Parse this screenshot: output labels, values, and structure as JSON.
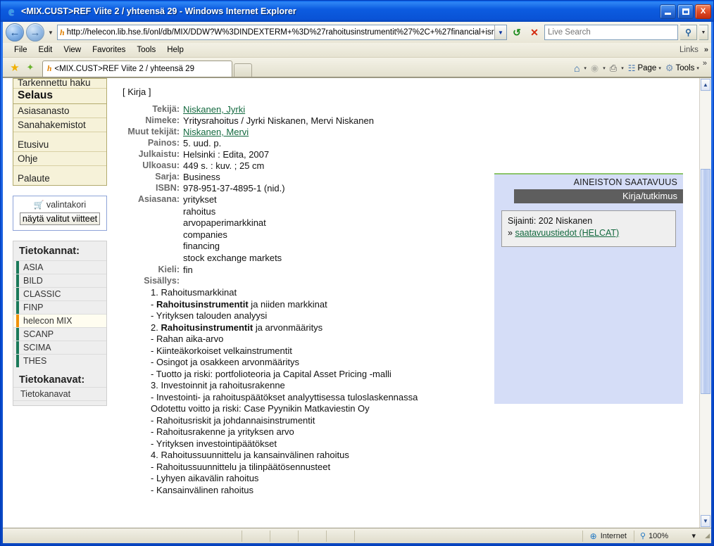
{
  "window": {
    "title": "<MIX.CUST>REF Viite 2 / yhteensä 29 - Windows Internet Explorer",
    "minimize_label": "Minimize",
    "maximize_label": "Maximize",
    "close_label": "X"
  },
  "address_bar": {
    "back_glyph": "←",
    "forward_glyph": "→",
    "history_glyph": "▼",
    "url": "http://helecon.lib.hse.fi/onl/db/MIX/DDW?W%3DINDEXTERM+%3D%27rahoitusinstrumentit%27%2C+%27financial+isr",
    "favicon_glyph": "h",
    "dropdown_glyph": "▼",
    "refresh_glyph": "↺",
    "stop_glyph": "✕",
    "search_placeholder": "Live Search",
    "search_value": "",
    "search_go_glyph": "⚲",
    "search_drop_glyph": "▼"
  },
  "menubar": {
    "items": [
      "File",
      "Edit",
      "View",
      "Favorites",
      "Tools",
      "Help"
    ],
    "links_label": "Links",
    "overflow_glyph": "»"
  },
  "tabrow": {
    "favorites_glyph": "★",
    "add_favorite_glyph": "✦",
    "tab_label": "<MIX.CUST>REF Viite 2 / yhteensä 29",
    "tab_favicon": "h",
    "new_tab_label": "",
    "commands": [
      {
        "name": "home",
        "icon": "⌂",
        "label": "",
        "arrow": "▾"
      },
      {
        "name": "feeds",
        "icon": "◉",
        "label": "",
        "arrow": "▾"
      },
      {
        "name": "print",
        "icon": "⎙",
        "label": "",
        "arrow": "▾"
      },
      {
        "name": "page",
        "icon": "☷",
        "label": "Page",
        "arrow": "▾"
      },
      {
        "name": "tools",
        "icon": "⚙",
        "label": "Tools",
        "arrow": "▾"
      }
    ],
    "overflow_glyph": "»"
  },
  "sidebar": {
    "nav_items": [
      {
        "label": "Tarkennettu haku",
        "type": "clipped"
      },
      {
        "label": "Selaus",
        "type": "heading"
      },
      {
        "label": "Asiasanasto",
        "type": "link"
      },
      {
        "label": "Sanahakemistot",
        "type": "link"
      },
      {
        "label": "",
        "type": "gap"
      },
      {
        "label": "Etusivu",
        "type": "link"
      },
      {
        "label": "Ohje",
        "type": "link"
      },
      {
        "label": "",
        "type": "gap"
      },
      {
        "label": "Palaute",
        "type": "link-last"
      }
    ],
    "cart": {
      "icon": "🛒",
      "label": "valintakori",
      "button_label": "näytä valitut viitteet"
    },
    "databases": {
      "heading": "Tietokannat:",
      "items": [
        {
          "label": "ASIA",
          "active": false
        },
        {
          "label": "BILD",
          "active": false
        },
        {
          "label": "CLASSIC",
          "active": false
        },
        {
          "label": "FINP",
          "active": false
        },
        {
          "label": "helecon MIX",
          "active": true
        },
        {
          "label": "SCANP",
          "active": false
        },
        {
          "label": "SCIMA",
          "active": false
        },
        {
          "label": "THES",
          "active": false
        }
      ],
      "channels_heading": "Tietokanavat:",
      "channels_item": "Tietokanavat"
    },
    "colors": {
      "nav_background": "#f6f2d9",
      "nav_border": "#b3ab6e",
      "db_marker": "#1b7a5a",
      "db_marker_active": "#f0920a",
      "link": "#13693f"
    }
  },
  "record": {
    "type_label": "[ Kirja ]",
    "fields": [
      {
        "label": "Tekijä:",
        "value": "Niskanen, Jyrki",
        "link": true
      },
      {
        "label": "Nimeke:",
        "value": "Yritysrahoitus / Jyrki Niskanen, Mervi Niskanen",
        "link": false
      },
      {
        "label": "Muut tekijät:",
        "value": "Niskanen, Mervi",
        "link": true
      },
      {
        "label": "Painos:",
        "value": "5. uud. p.",
        "link": false
      },
      {
        "label": "Julkaistu:",
        "value": "Helsinki : Edita, 2007",
        "link": false
      },
      {
        "label": "Ulkoasu:",
        "value": "449 s. : kuv. ; 25 cm",
        "link": false
      },
      {
        "label": "Sarja:",
        "value": "Business",
        "link": false
      },
      {
        "label": "ISBN:",
        "value": "978-951-37-4895-1 (nid.)",
        "link": false
      }
    ],
    "subject_label": "Asiasana:",
    "subjects": [
      "yritykset",
      "rahoitus",
      "arvopaperimarkkinat",
      "companies",
      "financing",
      "stock exchange markets"
    ],
    "language_label": "Kieli:",
    "language_value": "fin",
    "contents_label": "Sisällys:",
    "contents": [
      {
        "pre": "1. Rahoitusmarkkinat",
        "bold": "",
        "post": ""
      },
      {
        "pre": "- ",
        "bold": "Rahoitusinstrumentit",
        "post": " ja niiden markkinat"
      },
      {
        "pre": "- Yrityksen talouden analyysi",
        "bold": "",
        "post": ""
      },
      {
        "pre": "2. ",
        "bold": "Rahoitusinstrumentit",
        "post": " ja arvonmääritys"
      },
      {
        "pre": "- Rahan aika-arvo",
        "bold": "",
        "post": ""
      },
      {
        "pre": "- Kiinteäkorkoiset velkainstrumentit",
        "bold": "",
        "post": ""
      },
      {
        "pre": "- Osingot ja osakkeen arvonmääritys",
        "bold": "",
        "post": ""
      },
      {
        "pre": "- Tuotto ja riski: portfolioteoria ja Capital Asset Pricing -malli",
        "bold": "",
        "post": ""
      },
      {
        "pre": "3. Investoinnit ja rahoitusrakenne",
        "bold": "",
        "post": ""
      },
      {
        "pre": "- Investointi- ja rahoituspäätökset analyyttisessa tuloslaskennassa",
        "bold": "",
        "post": ""
      },
      {
        "pre": "Odotettu voitto ja riski: Case Pyynikin Matkaviestin Oy",
        "bold": "",
        "post": ""
      },
      {
        "pre": "- Rahoitusriskit ja johdannaisinstrumentit",
        "bold": "",
        "post": ""
      },
      {
        "pre": "- Rahoitusrakenne ja yrityksen arvo",
        "bold": "",
        "post": ""
      },
      {
        "pre": "- Yrityksen investointipäätökset",
        "bold": "",
        "post": ""
      },
      {
        "pre": "4. Rahoitussuunnittelu ja kansainvälinen rahoitus",
        "bold": "",
        "post": ""
      },
      {
        "pre": "- Rahoitussuunnittelu ja tilinpäätösennusteet",
        "bold": "",
        "post": ""
      },
      {
        "pre": "- Lyhyen aikavälin rahoitus",
        "bold": "",
        "post": ""
      },
      {
        "pre": "- Kansainvälinen rahoitus",
        "bold": "",
        "post": ""
      }
    ]
  },
  "availability": {
    "title": "AINEISTON SAATAVUUS",
    "subtitle": "Kirja/tutkimus",
    "location_line": "Sijainti: 202 Niskanen",
    "link_prefix": "»",
    "link_label": "saatavuustiedot (HELCAT)",
    "colors": {
      "panel_background": "#d5ddf7",
      "top_border": "#8cc46a",
      "header_bar": "#5e5e5e",
      "card_background": "#efefef"
    }
  },
  "scrollbar": {
    "up_glyph": "▲",
    "down_glyph": "▼"
  },
  "statusbar": {
    "zone_icon": "⊕",
    "zone_label": "Internet",
    "zoom_icon": "⚲",
    "zoom_label": "100%",
    "zoom_arrow": "▾",
    "grip": "◢"
  }
}
